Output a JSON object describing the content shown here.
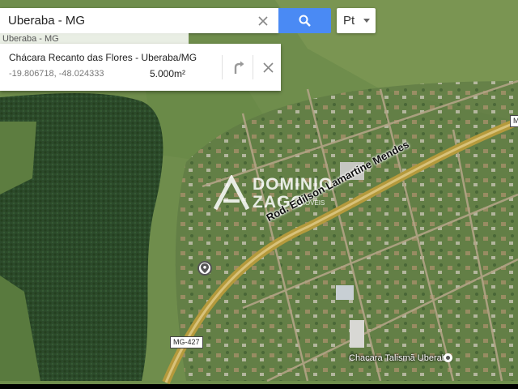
{
  "search": {
    "value": "Uberaba - MG",
    "clear_icon": "close-icon",
    "search_icon": "search-icon"
  },
  "language": {
    "selected": "Pt"
  },
  "suggestion": {
    "text": "Uberaba - MG"
  },
  "place_card": {
    "title": "Chácara Recanto das Flores - Uberaba/MG",
    "coordinates": "-19.806718, -48.024333",
    "area": "5.000m²",
    "directions_icon": "directions-icon",
    "close_icon": "close-icon"
  },
  "map": {
    "road_name": "Rod. Edilson Lamartine Mendes",
    "road_shield_bottom": "MG-427",
    "road_shield_right": "M",
    "poi_name": "Chacara Talismã Uberaba",
    "watermark": {
      "line1": "DOMINIO",
      "line2": "ZAGO",
      "line3": "IMOVEIS"
    },
    "colors": {
      "forest": "#2d4a2a",
      "pasture": "#6b8a4a",
      "road": "#b59a3c",
      "accent": "#4a8af4"
    }
  }
}
